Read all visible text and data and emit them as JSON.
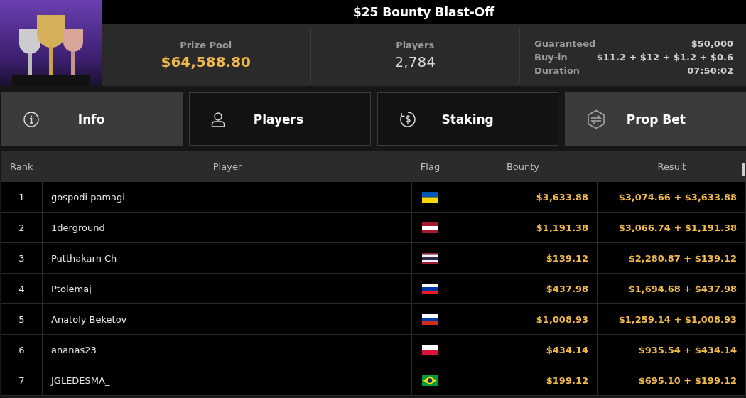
{
  "title": "$25 Bounty Blast-Off",
  "stats": [
    {
      "label": "Prize Pool",
      "value": "$64,588.80",
      "highlight": true
    },
    {
      "label": "Players",
      "value": "2,784",
      "highlight": false
    }
  ],
  "details": [
    {
      "label": "Guaranteed",
      "value": "$50,000"
    },
    {
      "label": "Buy-in",
      "value": "$11.2 + $12 + $1.2 + $0.6"
    },
    {
      "label": "Duration",
      "value": "07:50:02"
    }
  ],
  "tabs": [
    {
      "label": "Info",
      "selected": true
    },
    {
      "label": "Players",
      "selected": false
    },
    {
      "label": "Staking",
      "selected": false
    },
    {
      "label": "Prop Bet",
      "selected": true
    }
  ],
  "table": {
    "columns": [
      "Rank",
      "Player",
      "Flag",
      "Bounty",
      "Result"
    ],
    "rows": [
      {
        "rank": "1",
        "player": "gospodi pamagi",
        "bounty": "$3,633.88",
        "result": "$3,074.66 + $3,633.88"
      },
      {
        "rank": "2",
        "player": "1derground",
        "bounty": "$1,191.38",
        "result": "$3,066.74 + $1,191.38"
      },
      {
        "rank": "3",
        "player": "Putthakarn Ch-",
        "bounty": "$139.12",
        "result": "$2,280.87 + $139.12"
      },
      {
        "rank": "4",
        "player": "Ptolemaj",
        "bounty": "$437.98",
        "result": "$1,694.68 + $437.98"
      },
      {
        "rank": "5",
        "player": "Anatoly Beketov",
        "bounty": "$1,008.93",
        "result": "$1,259.14 + $1,008.93"
      },
      {
        "rank": "6",
        "player": "ananas23",
        "bounty": "$434.14",
        "result": "$935.54 + $434.14"
      },
      {
        "rank": "7",
        "player": "JGLEDESMA_",
        "bounty": "$199.12",
        "result": "$695.10 + $199.12"
      }
    ]
  }
}
